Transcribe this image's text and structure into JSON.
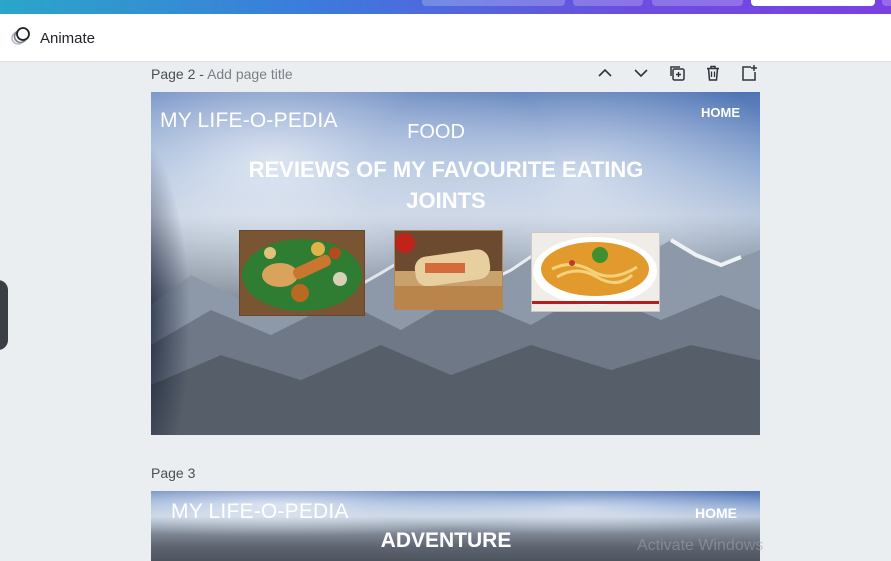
{
  "animate": {
    "label": "Animate"
  },
  "page2": {
    "number": "Page 2 -",
    "title_placeholder": "Add page title",
    "site_title": "MY LIFE-O-PEDIA",
    "home": "HOME",
    "section": "FOOD",
    "headline_line1": "REVIEWS OF MY FAVOURITE EATING",
    "headline_line2": "JOINTS"
  },
  "page3": {
    "number": "Page 3",
    "site_title": "MY LIFE-O-PEDIA",
    "home": "HOME",
    "section": "ADVENTURE"
  },
  "watermark": "Activate Windows"
}
